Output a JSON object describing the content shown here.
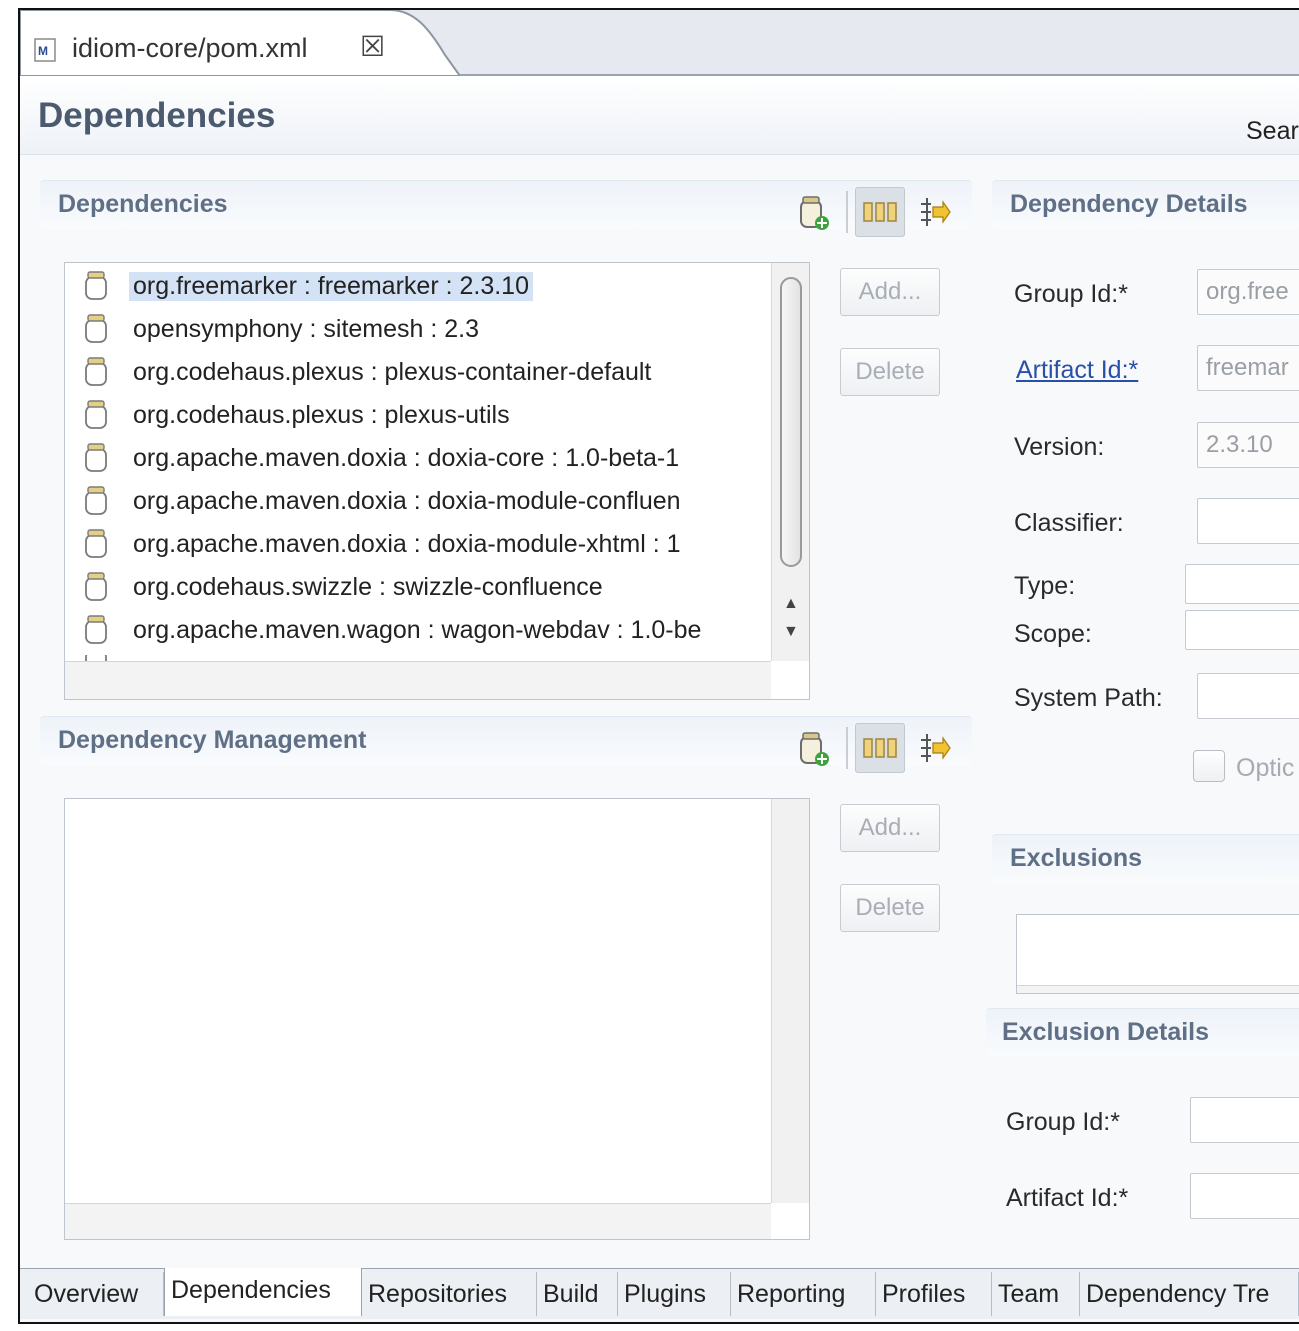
{
  "editor_tab": {
    "title": "idiom-core/pom.xml",
    "close_glyph": "☒",
    "file_icon": "maven-pom-icon"
  },
  "header": {
    "title": "Dependencies",
    "search_label": "Sear"
  },
  "dependencies_section": {
    "title": "Dependencies",
    "toolbar_icons": [
      "add-dependency-icon",
      "show-group-id-icon",
      "sort-icon"
    ],
    "items": [
      {
        "label": "org.freemarker : freemarker : 2.3.10",
        "selected": true
      },
      {
        "label": "opensymphony : sitemesh : 2.3",
        "selected": false
      },
      {
        "label": "org.codehaus.plexus : plexus-container-default",
        "selected": false
      },
      {
        "label": "org.codehaus.plexus : plexus-utils",
        "selected": false
      },
      {
        "label": "org.apache.maven.doxia : doxia-core : 1.0-beta-1",
        "selected": false
      },
      {
        "label": "org.apache.maven.doxia : doxia-module-confluen",
        "selected": false
      },
      {
        "label": "org.apache.maven.doxia : doxia-module-xhtml : 1",
        "selected": false
      },
      {
        "label": "org.codehaus.swizzle : swizzle-confluence",
        "selected": false
      },
      {
        "label": "org.apache.maven.wagon : wagon-webdav : 1.0-be",
        "selected": false
      }
    ],
    "add_label": "Add...",
    "delete_label": "Delete"
  },
  "dependency_management_section": {
    "title": "Dependency Management",
    "toolbar_icons": [
      "add-dependency-icon",
      "show-group-id-icon",
      "sort-icon"
    ],
    "items": [],
    "add_label": "Add...",
    "delete_label": "Delete"
  },
  "dependency_details": {
    "title": "Dependency Details",
    "group_id": {
      "label": "Group Id:*",
      "value": "org.free"
    },
    "artifact_id": {
      "label": "Artifact Id:*",
      "value": "freemar"
    },
    "version": {
      "label": "Version:",
      "value": "2.3.10"
    },
    "classifier": {
      "label": "Classifier:",
      "value": ""
    },
    "type": {
      "label": "Type:",
      "value": ""
    },
    "scope": {
      "label": "Scope:",
      "value": ""
    },
    "system_path": {
      "label": "System Path:",
      "value": ""
    },
    "optional": {
      "label": "Optic",
      "checked": false
    }
  },
  "exclusions": {
    "title": "Exclusions",
    "items": []
  },
  "exclusion_details": {
    "title": "Exclusion Details",
    "group_id": {
      "label": "Group Id:*",
      "value": ""
    },
    "artifact_id": {
      "label": "Artifact Id:*",
      "value": ""
    }
  },
  "bottom_tabs": [
    {
      "label": "Overview",
      "active": false
    },
    {
      "label": "Dependencies",
      "active": true
    },
    {
      "label": "Repositories",
      "active": false
    },
    {
      "label": "Build",
      "active": false
    },
    {
      "label": "Plugins",
      "active": false
    },
    {
      "label": "Reporting",
      "active": false
    },
    {
      "label": "Profiles",
      "active": false
    },
    {
      "label": "Team",
      "active": false
    },
    {
      "label": "Dependency Tre",
      "active": false
    }
  ],
  "colors": {
    "section_title": "#5e6f86",
    "page_title": "#4b5a6e",
    "selection": "#d4e2f5",
    "link": "#2850a8"
  }
}
